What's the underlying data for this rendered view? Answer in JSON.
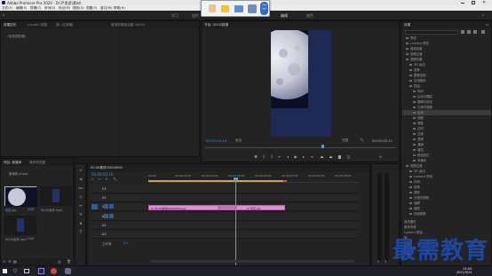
{
  "window": {
    "title": "Adobe Premiere Pro 2020 - D:\\严思思\\素材\\"
  },
  "menu": [
    "文件(F)",
    "编辑(E)",
    "剪辑(C)",
    "序列(S)",
    "标记(M)",
    "图形(G)",
    "视图(V)",
    "窗口(W)",
    "帮助(H)"
  ],
  "workspace_tabs": [
    "学习",
    "组件",
    "编辑",
    "颜色"
  ],
  "source_panel": {
    "tabs": [
      "效果控件",
      "Lumetri 范围",
      "源: (无剪辑)",
      "音频剪辑混合器: 00:00"
    ],
    "empty_text": "（未选择剪辑）"
  },
  "program_monitor": {
    "title": "节目: 00:00剪辑",
    "timecode_left": "00:00:03:16",
    "fit_label": "适合",
    "quality_label": "完整",
    "timecode_right": "00:00:05:11"
  },
  "effects_panel": {
    "title": "效果",
    "items": [
      "预设",
      "Lumetri 预设",
      "音频效果",
      "音频过渡",
      "视频效果",
      "3D 运动",
      "变换",
      "图像控制",
      "实用程序",
      "扭曲",
      "时间",
      "杂色与颗粒",
      "模糊与锐化",
      "沉浸式视频",
      "生成",
      "视频",
      "调整",
      "过时",
      "过渡",
      "透视",
      "通道",
      "键控",
      "颜色校正",
      "风格化",
      "视频过渡",
      "3D 运动",
      "Lumetri 预设",
      "内滑",
      "划像",
      "擦除",
      "沉浸式视频",
      "溶解",
      "缩放",
      "页面剥落"
    ],
    "bottom_items": [
      "基本图形",
      "基本声音",
      "Lumetri 颜色",
      "库",
      "标记",
      "历史记录",
      "信息"
    ]
  },
  "project_panel": {
    "tabs": [
      "项目: 新媒体",
      "媒体浏览器"
    ],
    "path": "新媒体.prproj",
    "items": [
      {
        "name": "天空.jpg",
        "duration": "5:00"
      },
      {
        "name": "00:00素材.mp4",
        "duration": ""
      },
      {
        "name": "00:00素材.mp4",
        "duration": "5:00"
      }
    ]
  },
  "timeline": {
    "sequence_tab": "00:00素材00000000",
    "timecode": "00:00:03:16",
    "ruler": [
      "00:00",
      "00:00:05:00",
      "00:00:10:00",
      "00:00:15:00",
      "00:00:20:00",
      "00:00:25:00",
      "00:00:30:00",
      "00:00:35:00"
    ],
    "video_tracks": [
      "V3",
      "V2",
      "V1"
    ],
    "audio_tracks": [
      "A1",
      "A2",
      "A3"
    ],
    "master_label": "主声道",
    "master_value": "0.0",
    "clips": [
      {
        "track": "V1",
        "label": "fx 00:00素材00000000.jpg"
      },
      {
        "track": "V1",
        "label": "fx 天空.jpg"
      }
    ]
  },
  "taskbar": {
    "time": "15:00",
    "date": "2021/9/24"
  },
  "watermark": {
    "text": "最需教育"
  },
  "colors": {
    "accent_blue": "#2d8ceb",
    "clip_pink": "#e58ad6",
    "playhead": "#5b9bd5",
    "watermark": "#1c47a8"
  }
}
